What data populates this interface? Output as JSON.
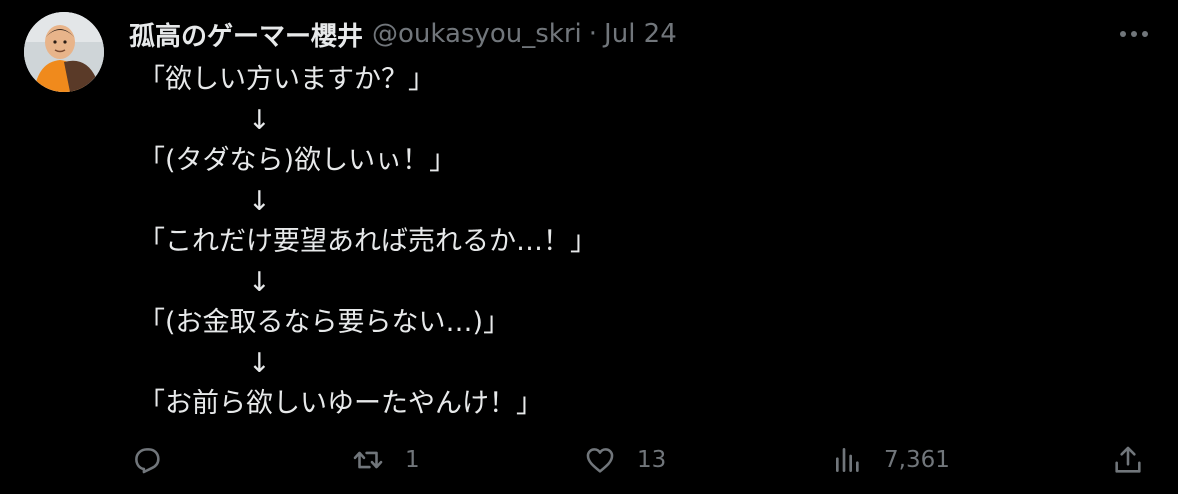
{
  "author": {
    "display_name": "孤高のゲーマー櫻井",
    "handle": "@oukasyou_skri",
    "separator": "·",
    "date": "Jul 24"
  },
  "menu": {
    "icon": "more-horizontal-icon"
  },
  "tweet": {
    "lines": [
      "「欲しい方いますか？」",
      "↓",
      "「(タダなら)欲しいぃ！」",
      "↓",
      "「これだけ要望あれば売れるか…！」",
      "↓",
      "「(お金取るなら要らない…)」",
      "↓",
      "「お前ら欲しいゆーたやんけ！」"
    ]
  },
  "actions": {
    "reply": {
      "icon": "reply-icon",
      "count": ""
    },
    "retweet": {
      "icon": "retweet-icon",
      "count": "1"
    },
    "like": {
      "icon": "heart-icon",
      "count": "13"
    },
    "views": {
      "icon": "views-icon",
      "count": "7,361"
    },
    "share": {
      "icon": "share-icon"
    }
  },
  "colors": {
    "background": "#000000",
    "text_primary": "#e7e9ea",
    "text_secondary": "#71767b"
  }
}
